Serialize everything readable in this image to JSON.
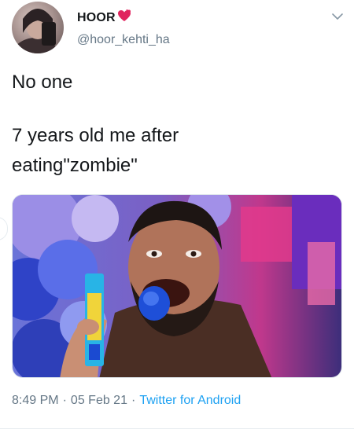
{
  "tweet": {
    "display_name": "HOOR",
    "handle": "@hoor_kehti_ha",
    "text_lines": [
      "No one",
      "7 years old me after",
      "eating\"zombie\""
    ],
    "time": "8:49 PM",
    "separator": "·",
    "date": "05 Feb 21",
    "source": "Twitter for Android"
  },
  "icons": {
    "name_emoji": "heart-icon",
    "menu": "chevron-down-icon"
  },
  "colors": {
    "text": "#14171a",
    "secondary": "#657786",
    "link": "#1da1f2",
    "heart": "#e0245e"
  }
}
